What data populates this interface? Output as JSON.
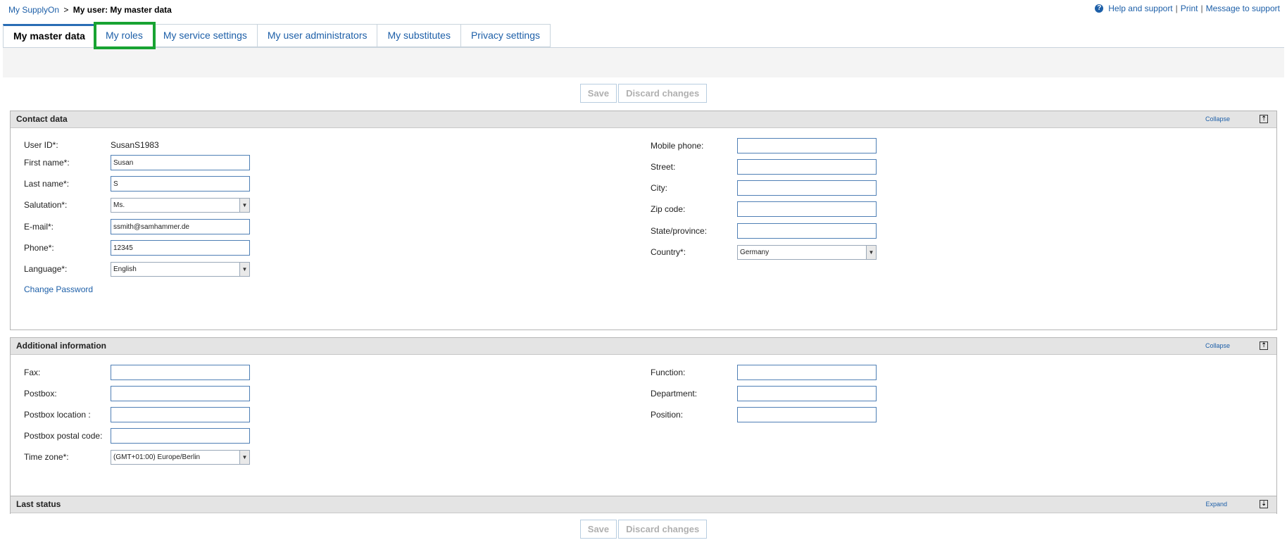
{
  "breadcrumb": {
    "home": "My SupplyOn",
    "separator": ">",
    "current": "My user: My master data"
  },
  "top_links": {
    "help": "Help and support",
    "print": "Print",
    "message": "Message to support",
    "pipe": "|",
    "help_icon": "?"
  },
  "tabs": [
    {
      "label": "My master data",
      "active": true
    },
    {
      "label": "My roles",
      "highlighted": true
    },
    {
      "label": "My service settings"
    },
    {
      "label": "My user administrators"
    },
    {
      "label": "My substitutes"
    },
    {
      "label": "Privacy settings"
    }
  ],
  "buttons": {
    "save": "Save",
    "discard": "Discard changes"
  },
  "contact": {
    "title": "Contact data",
    "toggle": "Collapse",
    "toggle_icon": "⇡",
    "user_id_label": "User ID*:",
    "user_id": "SusanS1983",
    "first_name_label": "First name*:",
    "first_name": "Susan",
    "last_name_label": "Last name*:",
    "last_name": "S",
    "salutation_label": "Salutation*:",
    "salutation": "Ms.",
    "email_label": "E-mail*:",
    "email": "ssmith@samhammer.de",
    "phone_label": "Phone*:",
    "phone": "12345",
    "language_label": "Language*:",
    "language": "English",
    "change_password": "Change Password",
    "mobile_label": "Mobile phone:",
    "mobile": "",
    "street_label": "Street:",
    "street": "",
    "city_label": "City:",
    "city": "",
    "zip_label": "Zip code:",
    "zip": "",
    "state_label": "State/province:",
    "state": "",
    "country_label": "Country*:",
    "country": "Germany"
  },
  "additional": {
    "title": "Additional information",
    "toggle": "Collapse",
    "toggle_icon": "⇡",
    "fax_label": "Fax:",
    "fax": "",
    "postbox_label": "Postbox:",
    "postbox": "",
    "postbox_location_label": "Postbox location :",
    "postbox_location": "",
    "postbox_postal_label": "Postbox postal code:",
    "postbox_postal": "",
    "timezone_label": "Time zone*:",
    "timezone": "(GMT+01:00) Europe/Berlin",
    "function_label": "Function:",
    "function": "",
    "department_label": "Department:",
    "department": "",
    "position_label": "Position:",
    "position": ""
  },
  "last_status": {
    "title": "Last status",
    "toggle": "Expand",
    "toggle_icon": "⇣"
  },
  "colors": {
    "link": "#1d5fa8",
    "highlight": "#18a332",
    "header_bg": "#e4e4e4"
  }
}
